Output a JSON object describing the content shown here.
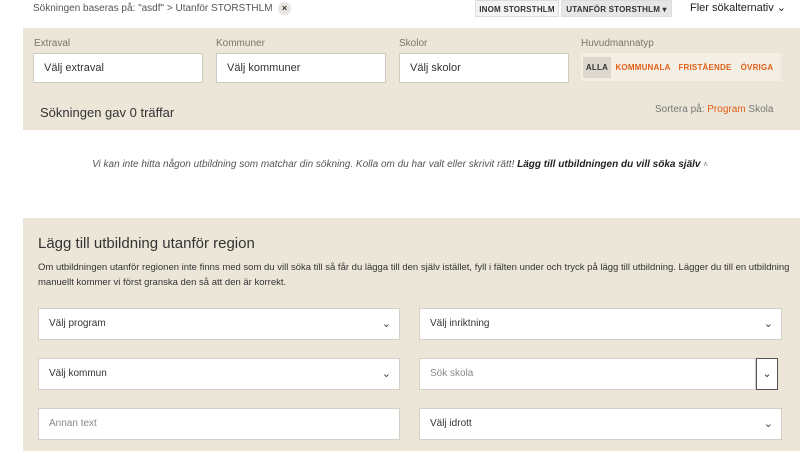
{
  "breadcrumb": {
    "text": "Sökningen baseras på: \"asdf\" > Utanför STORSTHLM",
    "close": "×"
  },
  "tabs": [
    {
      "label": "INOM STORSTHLM"
    },
    {
      "label": "UTANFÖR STORSTHLM ▾"
    }
  ],
  "more_options": "Fler sökalternativ ⌄",
  "filters": {
    "extraval": {
      "label": "Extraval",
      "value": "Välj extraval"
    },
    "kommuner": {
      "label": "Kommuner",
      "value": "Välj kommuner"
    },
    "skolor": {
      "label": "Skolor",
      "value": "Välj skolor"
    },
    "huvudman": {
      "label": "Huvudmannatyp",
      "options": [
        "ALLA",
        "KOMMUNALA",
        "FRISTÅENDE",
        "ÖVRIGA"
      ]
    }
  },
  "results": {
    "text": "Sökningen gav 0 träffar",
    "sort_label": "Sortera på:",
    "sort_program": "Program",
    "sort_skola": "Skola"
  },
  "no_match": {
    "text": "Vi kan inte hitta någon utbildning som matchar din sökning. Kolla om du har valt eller skrivit rätt!",
    "link": "Lägg till utbildningen du vill söka själv",
    "caret": "˄"
  },
  "add_section": {
    "title": "Lägg till utbildning utanför region",
    "description": "Om utbildningen utanför regionen inte finns med som du vill söka till så får du lägga till den själv istället, fyll i fälten under och tryck på lägg till utbildning. Lägger du till en utbildning manuellt kommer vi först granska den så att den är korrekt.",
    "program": "Välj program",
    "inriktning": "Välj inriktning",
    "kommun": "Välj kommun",
    "skola_placeholder": "Sök skola",
    "annan_text_placeholder": "Annan text",
    "idrott": "Välj idrott",
    "chevron": "⌄"
  },
  "colors": {
    "accent": "#e0601a",
    "panel": "#ebe6d8"
  }
}
